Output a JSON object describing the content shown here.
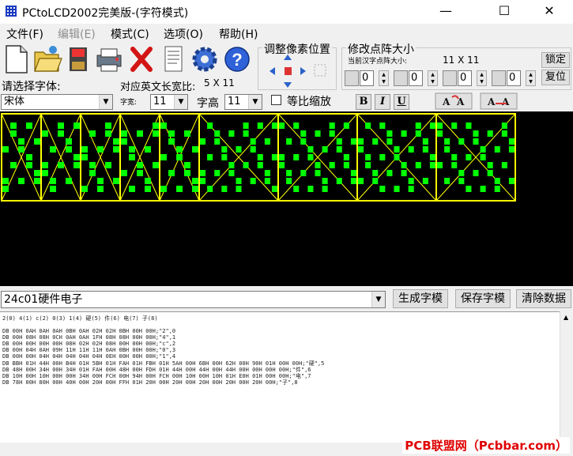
{
  "window": {
    "title": "PCtoLCD2002完美版-(字符模式)",
    "minimize": "—",
    "maximize": "☐",
    "close": "✕"
  },
  "menu": [
    {
      "label": "文件(F)",
      "enabled": true
    },
    {
      "label": "编辑(E)",
      "enabled": false
    },
    {
      "label": "模式(C)",
      "enabled": true
    },
    {
      "label": "选项(O)",
      "enabled": true
    },
    {
      "label": "帮助(H)",
      "enabled": true
    }
  ],
  "toolbar": {
    "icons": [
      "new-file-icon",
      "open-folder-icon",
      "save-icon",
      "print-icon",
      "delete-icon",
      "document-icon",
      "settings-gear-icon",
      "help-icon"
    ]
  },
  "position_group": {
    "title": "调整像素位置"
  },
  "matrix_group": {
    "title": "修改点阵大小",
    "current_label": "当前汉字点阵大小:",
    "current_value": "11 X 11",
    "lock_button": "锁定",
    "reset_button": "复位",
    "spin_values": [
      "0",
      "0",
      "0",
      "0"
    ]
  },
  "font": {
    "choose_label": "请选择字体:",
    "english_ratio_label": "对应英文长宽比:",
    "english_ratio_value": "5 X 11",
    "font_name": "宋体",
    "width_label": "字宽:",
    "width_value": "11",
    "height_label": "字高",
    "height_value": "11",
    "scale_label": "等比缩放",
    "scale_checked": false,
    "bold_label": "B",
    "italic_label": "I",
    "underline_label": "U"
  },
  "lcd": {
    "text": "24c01硬件电子",
    "pixel_color": "#00ff00",
    "grid_color": "#ffff00",
    "background": "#000000"
  },
  "input": {
    "value": "24c01硬件电子",
    "generate_button": "生成字模",
    "save_button": "保存字模",
    "clear_button": "清除数据"
  },
  "output": {
    "index_line": "2(0) 4(1) c(2) 0(3) 1(4) 硬(5) 件(6) 电(7) 子(8)",
    "lines": [
      "DB 00H 0AH 0AH 0AH 0BH 0AH 02H 02H 0BH 00H 00H;\"2\",0",
      "DB 00H 08H 08H 0CH 0AH 0AH 1FH 08H 08H 00H 00H;\"4\",1",
      "DB 00H 00H 00H 00H 08H 02H 02H 08H 00H 00H 00H;\"c\",2",
      "DB 00H 04H 0AH 09H 11H 11H 11H 0AH 0BH 00H 00H;\"0\",3",
      "DB 00H 00H 04H 04H 04H 04H 04H 0EH 00H 00H 00H;\"1\",4",
      "DB BBH 01H 44H 00H B4H 01H 5BH 01H FAH 01H FBH 01H 5AH 00H 6BH 00H 62H 00H 90H 01H 00H 00H;\"硬\",5",
      "DB 48H 00H 34H 00H 34H 01H FAH 00H 48H 00H FDH 01H 44H 00H 44H 00H 44H 00H 00H 00H 00H;\"件\",6",
      "DB 10H 00H 10H 00H 00H 34H 00H FCH 00H 94H 00H FCH 00H 10H 00H 10H 01H E0H 01H 00H 00H;\"电\",7",
      "DB 78H 00H 80H 00H 40H 00H 20H 00H FFH 01H 20H 00H 20H 00H 20H 00H 20H 00H 20H 00H;\"子\",8"
    ]
  },
  "watermark": "PCB联盟网（Pcbbar.com）"
}
